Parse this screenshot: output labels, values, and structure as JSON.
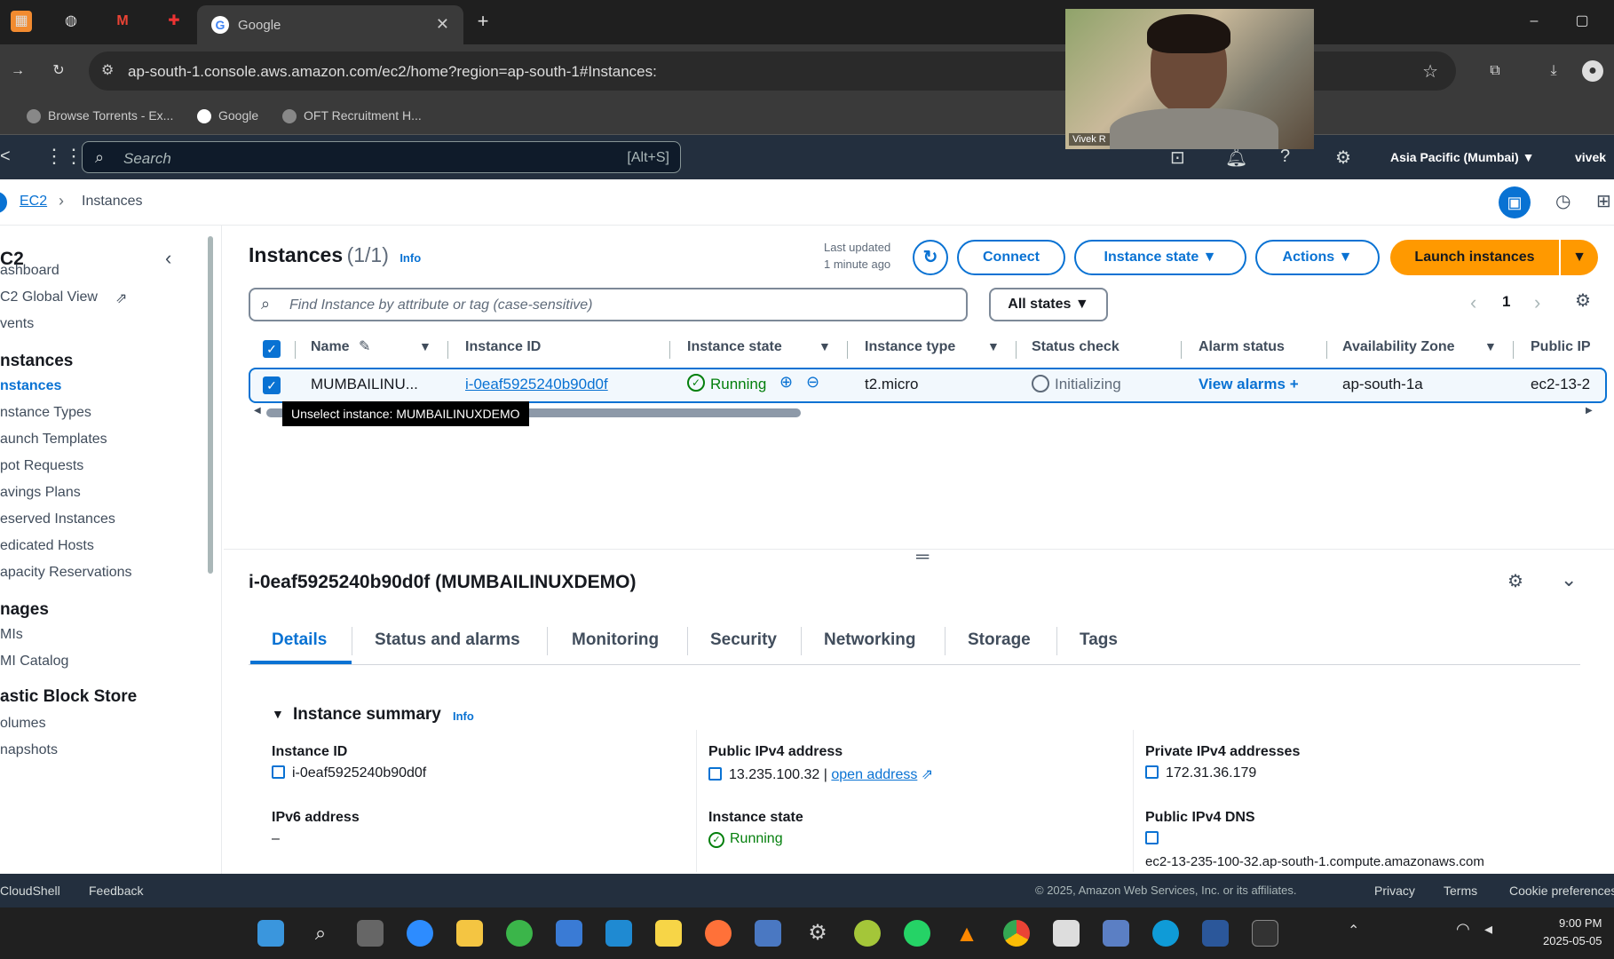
{
  "browser": {
    "tab_title": "Google",
    "url": "ap-south-1.console.aws.amazon.com/ec2/home?region=ap-south-1#Instances:",
    "bookmarks": [
      "Browse Torrents - Ex...",
      "Google",
      "OFT Recruitment H..."
    ]
  },
  "aws_nav": {
    "search_placeholder": "Search",
    "search_shortcut": "[Alt+S]",
    "region": "Asia Pacific (Mumbai) ▼",
    "user": "vivek"
  },
  "breadcrumb": {
    "ec2": "EC2",
    "current": "Instances"
  },
  "sidebar": {
    "title": "C2",
    "items": [
      {
        "kind": "item",
        "label": "ashboard"
      },
      {
        "kind": "item",
        "label": "C2 Global View"
      },
      {
        "kind": "item",
        "label": "vents"
      },
      {
        "kind": "head",
        "label": "nstances"
      },
      {
        "kind": "active",
        "label": "nstances"
      },
      {
        "kind": "item",
        "label": "nstance Types"
      },
      {
        "kind": "item",
        "label": "aunch Templates"
      },
      {
        "kind": "item",
        "label": "pot Requests"
      },
      {
        "kind": "item",
        "label": "avings Plans"
      },
      {
        "kind": "item",
        "label": "eserved Instances"
      },
      {
        "kind": "item",
        "label": "edicated Hosts"
      },
      {
        "kind": "item",
        "label": "apacity Reservations"
      },
      {
        "kind": "head",
        "label": "nages"
      },
      {
        "kind": "item",
        "label": "MIs"
      },
      {
        "kind": "item",
        "label": "MI Catalog"
      },
      {
        "kind": "head",
        "label": "astic Block Store"
      },
      {
        "kind": "item",
        "label": "olumes"
      },
      {
        "kind": "item",
        "label": "napshots"
      }
    ]
  },
  "instances": {
    "title": "Instances",
    "count": "(1/1)",
    "info": "Info",
    "last_updated_1": "Last updated",
    "last_updated_2": "1 minute ago",
    "connect": "Connect",
    "instance_state": "Instance state ▼",
    "actions": "Actions ▼",
    "launch": "Launch instances",
    "launch_caret": "▼",
    "find_placeholder": "Find Instance by attribute or tag (case-sensitive)",
    "all_states": "All states ▼",
    "page": "1",
    "columns": [
      "Name",
      "Instance ID",
      "Instance state",
      "Instance type",
      "Status check",
      "Alarm status",
      "Availability Zone",
      "Public IP"
    ],
    "row": {
      "name": "MUMBAILINU...",
      "id": "i-0eaf5925240b90d0f",
      "state": "Running",
      "type": "t2.micro",
      "status": "Initializing",
      "alarm": "View alarms +",
      "az": "ap-south-1a",
      "public_ip": "ec2-13-2"
    },
    "tooltip": "Unselect instance: MUMBAILINUXDEMO"
  },
  "details": {
    "heading": "i-0eaf5925240b90d0f (MUMBAILINUXDEMO)",
    "tabs": [
      "Details",
      "Status and alarms",
      "Monitoring",
      "Security",
      "Networking",
      "Storage",
      "Tags"
    ],
    "summary": "Instance summary",
    "info": "Info",
    "instance_id_label": "Instance ID",
    "instance_id": "i-0eaf5925240b90d0f",
    "public_ipv4_label": "Public IPv4 address",
    "public_ipv4": "13.235.100.32",
    "open_address": "open address",
    "private_ipv4_label": "Private IPv4 addresses",
    "private_ipv4": "172.31.36.179",
    "ipv6_label": "IPv6 address",
    "ipv6": "–",
    "state_label": "Instance state",
    "state": "Running",
    "dns_label": "Public IPv4 DNS",
    "dns": "ec2-13-235-100-32.ap-south-1.compute.amazonaws.com"
  },
  "footer": {
    "cloudshell": "CloudShell",
    "feedback": "Feedback",
    "copyright": "© 2025, Amazon Web Services, Inc. or its affiliates.",
    "privacy": "Privacy",
    "terms": "Terms",
    "cookies": "Cookie preferences"
  },
  "taskbar": {
    "time": "9:00 PM",
    "date": "2025-05-05"
  },
  "webcam": {
    "name": "Vivek R"
  },
  "colors": {
    "aws_nav": "#232f3e",
    "link": "#0972d3",
    "launch": "#ff9900",
    "running": "#037f0c"
  }
}
